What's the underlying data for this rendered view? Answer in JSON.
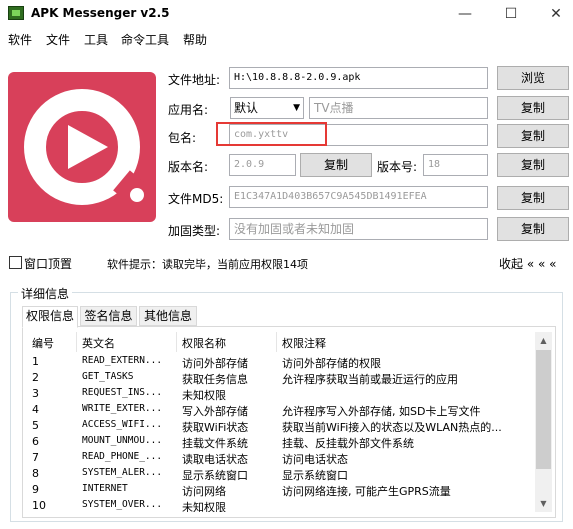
{
  "window": {
    "title": "APK Messenger v2.5",
    "minimize": "—",
    "maximize": "☐",
    "close": "✕"
  },
  "menu": [
    "软件",
    "文件",
    "工具",
    "命令工具",
    "帮助"
  ],
  "form": {
    "file_path_label": "文件地址:",
    "file_path_value": "H:\\10.8.8.8-2.0.9.apk",
    "browse_button": "浏览",
    "app_name_label": "应用名:",
    "app_name_select": "默认",
    "app_name_value": "TV点播",
    "copy_button": "复制",
    "package_label": "包名:",
    "package_value": "com.yxttv",
    "version_name_label": "版本名:",
    "version_name_value": "2.0.9",
    "version_code_label": "版本号:",
    "version_code_value": "18",
    "md5_label": "文件MD5:",
    "md5_value": "E1C347A1D403B657C9A545DB1491EFEA",
    "shell_label": "加固类型:",
    "shell_value": "没有加固或者未知加固"
  },
  "options": {
    "topmost_label": "窗口顶置",
    "tip_text": "软件提示：读取完毕，当前应用权限14项",
    "collapse_label": "收起 « « «"
  },
  "details": {
    "group_title": "详细信息",
    "tabs": [
      "权限信息",
      "签名信息",
      "其他信息"
    ],
    "columns": [
      "编号",
      "英文名",
      "权限名称",
      "权限注释"
    ],
    "rows": [
      [
        "1",
        "READ_EXTERN...",
        "访问外部存储",
        "访问外部存储的权限"
      ],
      [
        "2",
        "GET_TASKS",
        "获取任务信息",
        "允许程序获取当前或最近运行的应用"
      ],
      [
        "3",
        "REQUEST_INS...",
        "未知权限",
        ""
      ],
      [
        "4",
        "WRITE_EXTER...",
        "写入外部存储",
        "允许程序写入外部存储, 如SD卡上写文件"
      ],
      [
        "5",
        "ACCESS_WIFI...",
        "获取WiFi状态",
        "获取当前WiFi接入的状态以及WLAN热点的..."
      ],
      [
        "6",
        "MOUNT_UNMOU...",
        "挂载文件系统",
        "挂载、反挂载外部文件系统"
      ],
      [
        "7",
        "READ_PHONE_...",
        "读取电话状态",
        "访问电话状态"
      ],
      [
        "8",
        "SYSTEM_ALER...",
        "显示系统窗口",
        "显示系统窗口"
      ],
      [
        "9",
        "INTERNET",
        "访问网络",
        "访问网络连接, 可能产生GPRS流量"
      ],
      [
        "10",
        "SYSTEM_OVER...",
        "未知权限",
        ""
      ]
    ]
  },
  "colors": {
    "logo_bg": "#d8405a",
    "highlight": "#e53935"
  }
}
